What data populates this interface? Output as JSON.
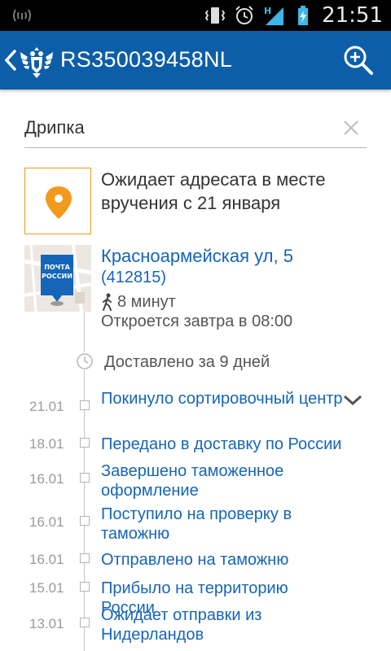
{
  "status_bar": {
    "time": "21:51",
    "icons": [
      "signal-alert-icon",
      "vibrate-icon",
      "alarm-icon",
      "network-h-icon",
      "battery-charging-icon"
    ]
  },
  "app_bar": {
    "title": "RS350039458NL",
    "back_icon": "chevron-left-icon",
    "logo_icon": "russian-post-eagle-icon",
    "action_icon": "zoom-in-icon",
    "color": "#0d5ea8"
  },
  "search": {
    "value": "Дрипка"
  },
  "status": {
    "text": "Ожидает адресата в месте вручения с 21 января",
    "accent_color": "#f19a1e"
  },
  "office": {
    "name": "Красноармейская ул, 5",
    "index": "(412815)",
    "walk_time": "8 минут",
    "opens": "Откроется завтра в 08:00",
    "map_logo_line1": "ПОЧТА",
    "map_logo_line2": "РОССИИ"
  },
  "timeline": {
    "delivered": "Доставлено за 9 дней",
    "events": [
      {
        "date": "21.01",
        "label": "Покинуло сортировочный центр"
      },
      {
        "date": "18.01",
        "label": "Передано в доставку по России"
      },
      {
        "date": "16.01",
        "label": "Завершено таможенное оформление"
      },
      {
        "date": "16.01",
        "label": "Поступило на проверку в таможню"
      },
      {
        "date": "16.01",
        "label": "Отправлено на таможню"
      },
      {
        "date": "15.01",
        "label": "Прибыло на территорию России"
      },
      {
        "date": "13.01",
        "label": "Ожидает отправки из Нидерландов"
      }
    ]
  }
}
